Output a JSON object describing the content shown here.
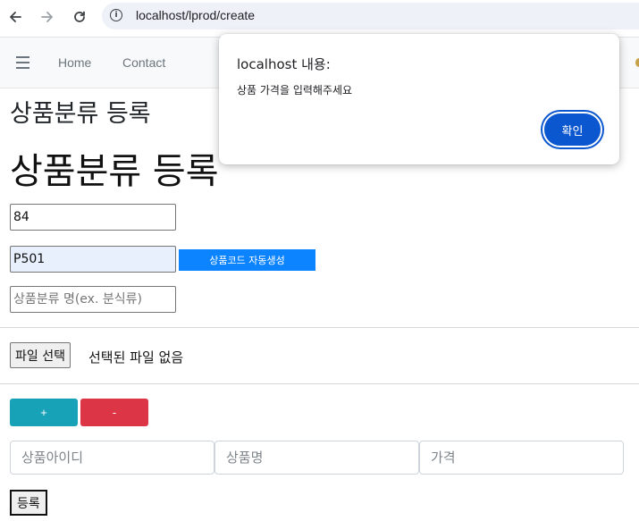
{
  "browser": {
    "url": "localhost/lprod/create"
  },
  "navbar": {
    "links": [
      "Home",
      "Contact"
    ]
  },
  "page": {
    "heading_small": "상품분류 등록",
    "heading_large": "상품분류 등록",
    "id_value": "84",
    "code_value": "P501",
    "auto_code_button": "상품코드 자동생성",
    "name_placeholder": "상품분류 명(ex. 분식류)",
    "file_button": "파일 선택",
    "file_status": "선택된 파일 없음",
    "add_button": "+",
    "remove_button": "-",
    "product_row": {
      "id_placeholder": "상품아이디",
      "name_placeholder": "상품명",
      "price_placeholder": "가격"
    },
    "submit_button": "등록"
  },
  "alert": {
    "title": "localhost 내용:",
    "message": "상품 가격을 입력해주세요",
    "ok_button": "확인"
  },
  "colors": {
    "primary": "#0d84ff",
    "info": "#17a2b8",
    "danger": "#dc3545",
    "dialog_button": "#0b57d0"
  },
  "icons": {
    "back": "arrow-left",
    "forward": "arrow-right",
    "reload": "reload",
    "site_info": "info",
    "menu": "hamburger"
  }
}
